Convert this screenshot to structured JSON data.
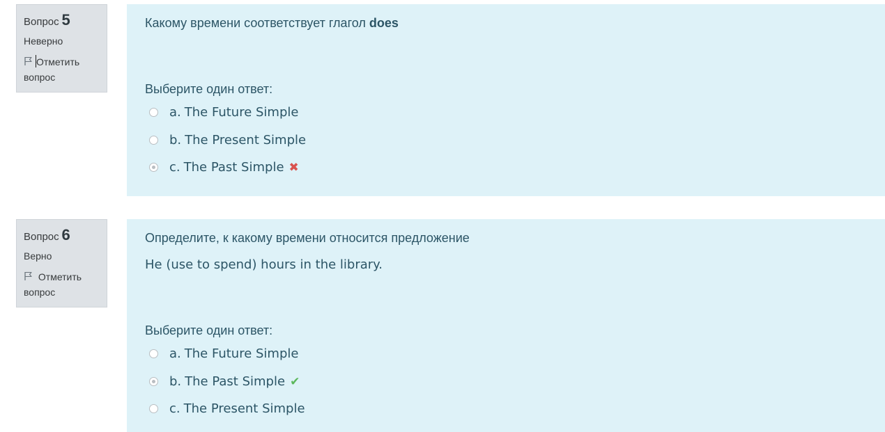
{
  "questions": [
    {
      "label": "Вопрос",
      "number": "5",
      "state": "Неверно",
      "flag_label": "Отметить",
      "flag_label_2": "вопрос",
      "text_prefix": "Какому времени соответствует глагол ",
      "text_bold": "does",
      "sentence": "",
      "prompt": "Выберите один ответ:",
      "options": [
        {
          "letter": "a.",
          "text": "The Future Simple",
          "selected": false,
          "mark": ""
        },
        {
          "letter": "b.",
          "text": "The Present Simple",
          "selected": false,
          "mark": ""
        },
        {
          "letter": "c.",
          "text": "The Past Simple",
          "selected": true,
          "mark": "✖"
        }
      ]
    },
    {
      "label": "Вопрос",
      "number": "6",
      "state": "Верно",
      "flag_label": "Отметить",
      "flag_label_2": "вопрос",
      "text_prefix": "Определите, к какому времени относится предложение",
      "text_bold": "",
      "sentence": "He (use to spend) hours in the library.",
      "prompt": "Выберите один ответ:",
      "options": [
        {
          "letter": "a.",
          "text": "The Future Simple",
          "selected": false,
          "mark": ""
        },
        {
          "letter": "b.",
          "text": "The Past Simple",
          "selected": true,
          "mark": "✔"
        },
        {
          "letter": "c.",
          "text": "The Present Simple",
          "selected": false,
          "mark": ""
        }
      ]
    }
  ],
  "colors": {
    "info_bg": "#dee2e6",
    "content_bg": "#def2f8",
    "text": "#2c5566",
    "incorrect": "#d9534f",
    "correct": "#5cb85c"
  },
  "icons": {
    "flag": "flag-icon",
    "incorrect": "cross-icon",
    "correct": "check-icon"
  }
}
